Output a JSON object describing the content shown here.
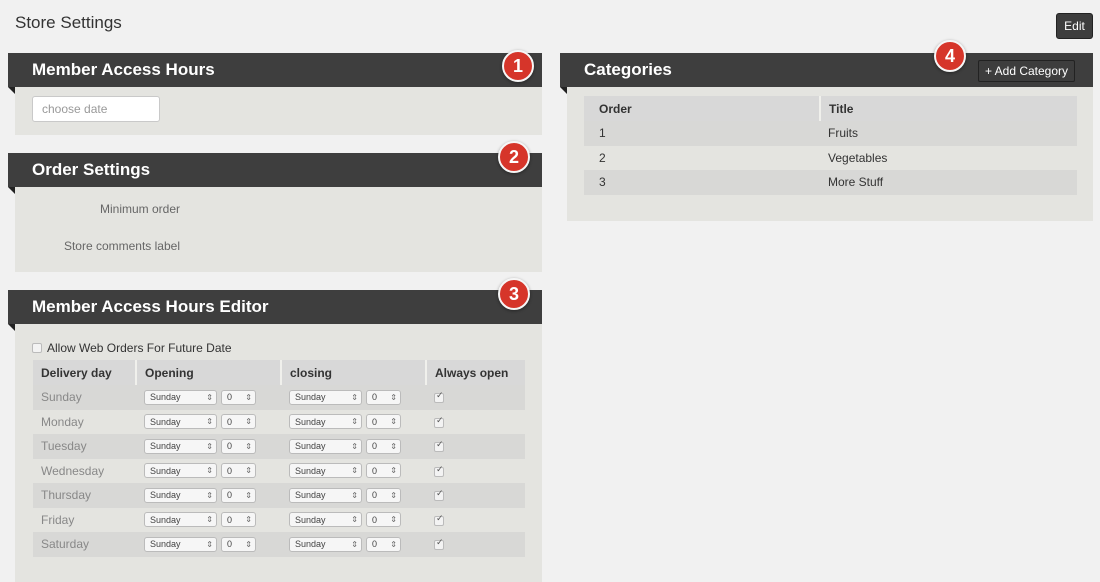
{
  "page": {
    "title": "Store Settings",
    "edit_label": "Edit"
  },
  "colors": {
    "header_bg": "#3e3e3e",
    "badge": "#d6352a",
    "panel_bg": "#e4e4e0",
    "page_bg": "#f1f1f1"
  },
  "panels": {
    "member_access": {
      "title": "Member Access Hours",
      "badge": "1",
      "date_placeholder": "choose date"
    },
    "order_settings": {
      "title": "Order Settings",
      "badge": "2",
      "minimum_order_label": "Minimum order",
      "comments_label": "Store comments label"
    },
    "hours_editor": {
      "title": "Member Access Hours Editor",
      "badge": "3",
      "allow_future_label": "Allow Web Orders For Future Date",
      "columns": [
        "Delivery day",
        "Opening",
        "closing",
        "Always open"
      ],
      "rows": [
        {
          "day": "Sunday",
          "open_day": "Sunday",
          "open_hour": "0",
          "close_day": "Sunday",
          "close_hour": "0",
          "always_open": true
        },
        {
          "day": "Monday",
          "open_day": "Sunday",
          "open_hour": "0",
          "close_day": "Sunday",
          "close_hour": "0",
          "always_open": true
        },
        {
          "day": "Tuesday",
          "open_day": "Sunday",
          "open_hour": "0",
          "close_day": "Sunday",
          "close_hour": "0",
          "always_open": true
        },
        {
          "day": "Wednesday",
          "open_day": "Sunday",
          "open_hour": "0",
          "close_day": "Sunday",
          "close_hour": "0",
          "always_open": true
        },
        {
          "day": "Thursday",
          "open_day": "Sunday",
          "open_hour": "0",
          "close_day": "Sunday",
          "close_hour": "0",
          "always_open": true
        },
        {
          "day": "Friday",
          "open_day": "Sunday",
          "open_hour": "0",
          "close_day": "Sunday",
          "close_hour": "0",
          "always_open": true
        },
        {
          "day": "Saturday",
          "open_day": "Sunday",
          "open_hour": "0",
          "close_day": "Sunday",
          "close_hour": "0",
          "always_open": true
        }
      ]
    },
    "categories": {
      "title": "Categories",
      "badge": "4",
      "add_label": "+ Add Category",
      "columns": [
        "Order",
        "Title"
      ],
      "rows": [
        {
          "order": "1",
          "title": "Fruits"
        },
        {
          "order": "2",
          "title": "Vegetables"
        },
        {
          "order": "3",
          "title": "More Stuff"
        }
      ]
    }
  }
}
